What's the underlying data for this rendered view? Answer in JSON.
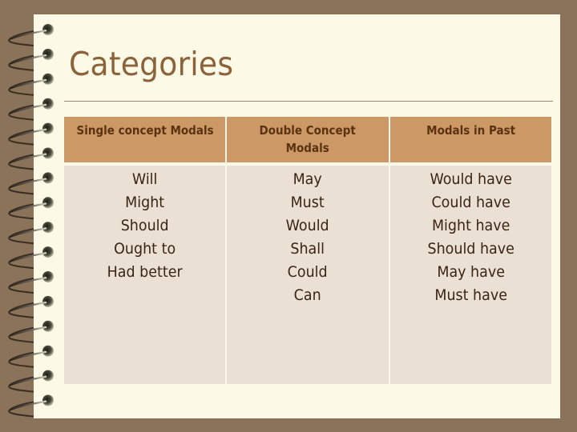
{
  "slide": {
    "title": "Categories",
    "table": {
      "headers": [
        "Single concept  Modals",
        "Double Concept Modals",
        "Modals in Past"
      ],
      "columns": [
        [
          "Will",
          "Might",
          "Should",
          "Ought to",
          "Had better"
        ],
        [
          "May",
          "Must",
          "Would",
          "Shall",
          "Could",
          "Can"
        ],
        [
          "Would have",
          "Could have",
          "Might have",
          "Should have",
          "May have",
          "Must have"
        ]
      ]
    }
  },
  "colors": {
    "background": "#8b7359",
    "page": "#fcfae6",
    "title": "#8b6239",
    "header_fill": "#cc9966",
    "header_text": "#5a3210",
    "cell_fill": "#eae0d4",
    "cell_text": "#3a2414"
  },
  "decor": {
    "binding": "spiral-rings",
    "ring_count": 16
  }
}
